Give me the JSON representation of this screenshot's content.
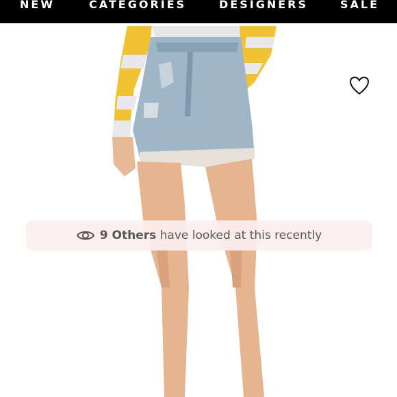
{
  "nav": {
    "items": [
      {
        "label": "NEW"
      },
      {
        "label": "CATEGORIES"
      },
      {
        "label": "DESIGNERS"
      },
      {
        "label": "SALE"
      }
    ]
  },
  "product": {
    "image_icon": "product-photo",
    "wishlist_icon": "heart-icon"
  },
  "social_proof": {
    "icon": "eye-icon",
    "count_text": "9 Others",
    "message": "have looked at this recently"
  },
  "colors": {
    "nav_bg": "#000000",
    "banner_bg": "#fceeee",
    "text": "#555555"
  }
}
